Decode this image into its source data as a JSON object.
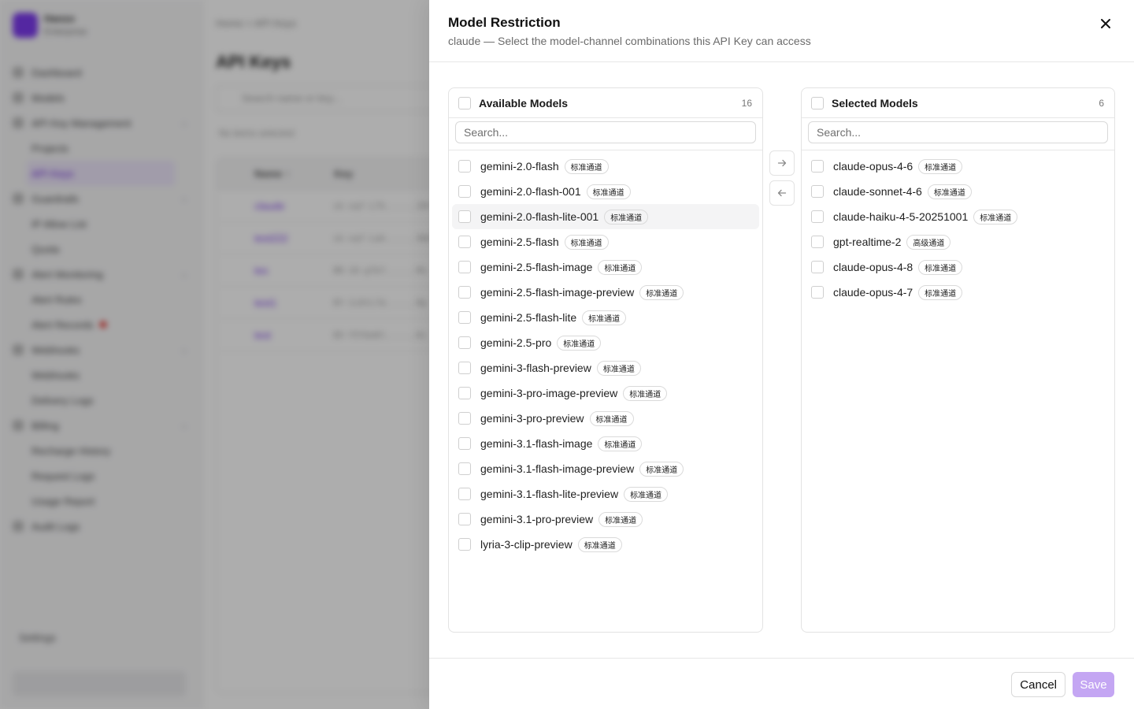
{
  "background": {
    "brand": {
      "name": "Hanzo",
      "sub": "Enterprise"
    },
    "sidebar_items": [
      {
        "label": "Dashboard",
        "sub": false
      },
      {
        "label": "Models",
        "sub": false
      },
      {
        "label": "API Key Management",
        "sub": false,
        "expandable": true
      },
      {
        "label": "Projects",
        "sub": true
      },
      {
        "label": "API Keys",
        "sub": true,
        "active": true
      },
      {
        "label": "Guardrails",
        "sub": false,
        "expandable": true
      },
      {
        "label": "IP Allow List",
        "sub": true
      },
      {
        "label": "Quota",
        "sub": true
      },
      {
        "label": "Alert Monitoring",
        "sub": false,
        "expandable": true
      },
      {
        "label": "Alert Rules",
        "sub": true
      },
      {
        "label": "Alert Records",
        "sub": true,
        "badge": true
      },
      {
        "label": "Webhooks",
        "sub": false,
        "expandable": true
      },
      {
        "label": "Webhooks",
        "sub": true
      },
      {
        "label": "Delivery Logs",
        "sub": true
      },
      {
        "label": "Billing",
        "sub": false,
        "expandable": true
      },
      {
        "label": "Recharge History",
        "sub": true
      },
      {
        "label": "Request Logs",
        "sub": true
      },
      {
        "label": "Usage Report",
        "sub": true
      },
      {
        "label": "Audit Logs",
        "sub": false
      }
    ],
    "settings_label": "Settings",
    "breadcrumb": "Home  >  API Keys",
    "page_title": "API Keys",
    "search_placeholder": "Search name or key...",
    "selection_text": "No items selected",
    "table_headers": [
      "Name ↑",
      "Key"
    ],
    "table_rows": [
      {
        "name": "claude",
        "key": "sk-xqf-L7k......2Ht"
      },
      {
        "name": "test222",
        "key": "sk-xqf-Lah......9bE"
      },
      {
        "name": "tes",
        "key": "8R-16-g7kf......Ms"
      },
      {
        "name": "test1",
        "key": "8Y-1cDtL7d......Rp"
      },
      {
        "name": "test",
        "key": "8X-Y5fbeKt......Kc"
      }
    ]
  },
  "drawer": {
    "title": "Model Restriction",
    "subtitle": "claude — Select the model-channel combinations this API Key can access",
    "save_label": "Save",
    "cancel_label": "Cancel"
  },
  "available": {
    "title": "Available Models",
    "count": "16",
    "search_placeholder": "Search...",
    "items": [
      {
        "name": "gemini-2.0-flash",
        "tag": "标准通道"
      },
      {
        "name": "gemini-2.0-flash-001",
        "tag": "标准通道"
      },
      {
        "name": "gemini-2.0-flash-lite-001",
        "tag": "标准通道"
      },
      {
        "name": "gemini-2.5-flash",
        "tag": "标准通道"
      },
      {
        "name": "gemini-2.5-flash-image",
        "tag": "标准通道"
      },
      {
        "name": "gemini-2.5-flash-image-preview",
        "tag": "标准通道"
      },
      {
        "name": "gemini-2.5-flash-lite",
        "tag": "标准通道"
      },
      {
        "name": "gemini-2.5-pro",
        "tag": "标准通道"
      },
      {
        "name": "gemini-3-flash-preview",
        "tag": "标准通道"
      },
      {
        "name": "gemini-3-pro-image-preview",
        "tag": "标准通道"
      },
      {
        "name": "gemini-3-pro-preview",
        "tag": "标准通道"
      },
      {
        "name": "gemini-3.1-flash-image",
        "tag": "标准通道"
      },
      {
        "name": "gemini-3.1-flash-image-preview",
        "tag": "标准通道"
      },
      {
        "name": "gemini-3.1-flash-lite-preview",
        "tag": "标准通道"
      },
      {
        "name": "gemini-3.1-pro-preview",
        "tag": "标准通道"
      },
      {
        "name": "lyria-3-clip-preview",
        "tag": "标准通道"
      }
    ]
  },
  "selected": {
    "title": "Selected Models",
    "count": "6",
    "search_placeholder": "Search...",
    "items": [
      {
        "name": "claude-opus-4-6",
        "tag": "标准通道"
      },
      {
        "name": "claude-sonnet-4-6",
        "tag": "标准通道"
      },
      {
        "name": "claude-haiku-4-5-20251001",
        "tag": "标准通道"
      },
      {
        "name": "gpt-realtime-2",
        "tag": "高级通道"
      },
      {
        "name": "claude-opus-4-8",
        "tag": "标准通道"
      },
      {
        "name": "claude-opus-4-7",
        "tag": "标准通道"
      }
    ]
  },
  "colors": {
    "accent": "#7c3aed",
    "save_button_disabled": "#c4a6f3",
    "overlay": "rgba(0,0,0,0.32)"
  }
}
